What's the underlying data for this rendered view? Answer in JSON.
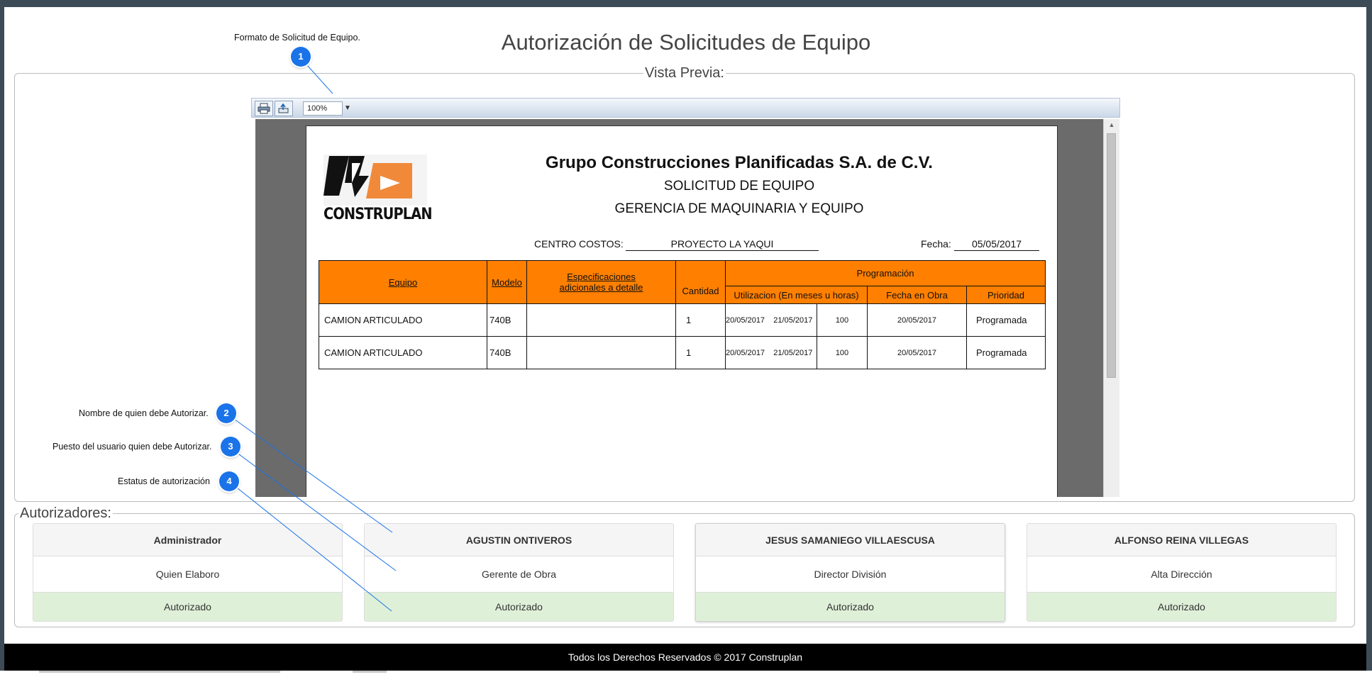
{
  "page": {
    "title": "Autorización de Solicitudes de Equipo",
    "preview_legend": "Vista Previa:",
    "authorizers_legend": "Autorizadores:",
    "footer": "Todos los Derechos Reservados © 2017 Construplan"
  },
  "viewer": {
    "print_icon": "printer-icon",
    "export_icon": "export-icon",
    "zoom": "100%"
  },
  "report": {
    "logo_text": "CONSTRUPLAN",
    "company": "Grupo Construcciones Planificadas S.A. de C.V.",
    "subtitle1": "SOLICITUD DE EQUIPO",
    "subtitle2": "GERENCIA DE MAQUINARIA Y EQUIPO",
    "cost_center_label": "CENTRO COSTOS:",
    "cost_center_value": "PROYECTO LA YAQUI",
    "date_label": "Fecha:",
    "date_value": "05/05/2017",
    "headers": {
      "equipo": "Equipo",
      "modelo": "Modelo",
      "especificaciones_1": "Especificaciones",
      "especificaciones_2": "adicionales a detalle",
      "cantidad": "Cantidad",
      "programacion": "Programación",
      "utilizacion": "Utilizacion (En meses u horas)",
      "fecha_obra": "Fecha en Obra",
      "prioridad": "Prioridad"
    },
    "rows": [
      {
        "equipo": "CAMION ARTICULADO",
        "modelo": "740B",
        "especificaciones": "",
        "cantidad": "1",
        "util_inicio": "20/05/2017",
        "util_fin": "21/05/2017",
        "horas": "100",
        "fecha_obra": "20/05/2017",
        "prioridad": "Programada"
      },
      {
        "equipo": "CAMION ARTICULADO",
        "modelo": "740B",
        "especificaciones": "",
        "cantidad": "1",
        "util_inicio": "20/05/2017",
        "util_fin": "21/05/2017",
        "horas": "100",
        "fecha_obra": "20/05/2017",
        "prioridad": "Programada"
      }
    ]
  },
  "callouts": [
    {
      "number": "1",
      "label": "Formato de Solicitud de Equipo."
    },
    {
      "number": "2",
      "label": "Nombre de quien debe Autorizar."
    },
    {
      "number": "3",
      "label": "Puesto del usuario quien debe Autorizar."
    },
    {
      "number": "4",
      "label": "Estatus de autorización"
    }
  ],
  "authorizers": [
    {
      "name": "Administrador",
      "role": "Quien Elaboro",
      "status": "Autorizado"
    },
    {
      "name": "AGUSTIN ONTIVEROS",
      "role": "Gerente de Obra",
      "status": "Autorizado"
    },
    {
      "name": "JESUS SAMANIEGO VILLAESCUSA",
      "role": "Director División",
      "status": "Autorizado"
    },
    {
      "name": "ALFONSO REINA VILLEGAS",
      "role": "Alta Dirección",
      "status": "Autorizado"
    }
  ],
  "colors": {
    "header_orange": "#ff7f00",
    "callout_blue": "#1a73e8",
    "status_green": "#dff0d8"
  }
}
